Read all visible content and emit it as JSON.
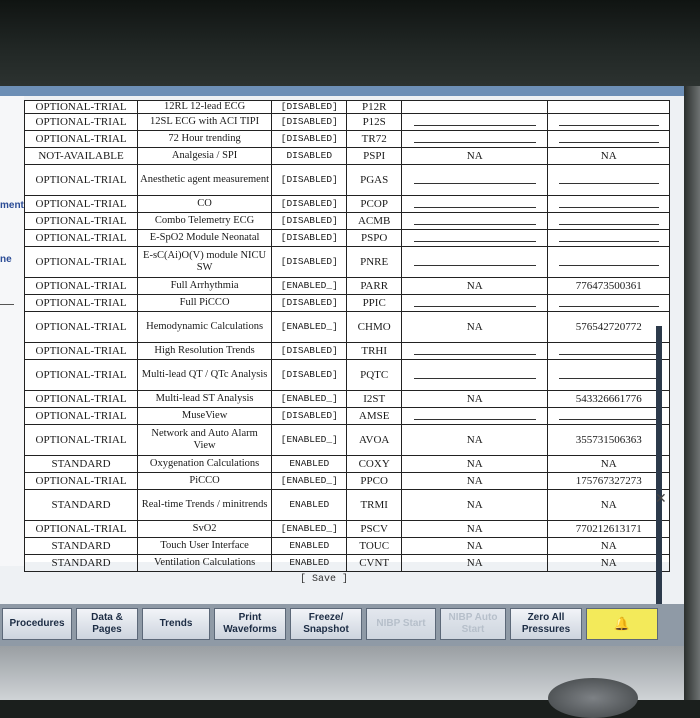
{
  "left_sidebar": {
    "label_1": "ment",
    "label_2": "ne"
  },
  "table": {
    "partial_row": {
      "status": "OPTIONAL-TRIAL",
      "feature": "12RL 12-lead ECG",
      "state": "[DISABLED]",
      "code": "P12R"
    },
    "rows": [
      {
        "status": "OPTIONAL-TRIAL",
        "feature": "12SL ECG with ACI TIPI",
        "state": "[DISABLED]",
        "code": "P12S",
        "a": "",
        "b": ""
      },
      {
        "status": "OPTIONAL-TRIAL",
        "feature": "72 Hour trending",
        "state": "[DISABLED]",
        "code": "TR72",
        "a": "",
        "b": ""
      },
      {
        "status": "NOT-AVAILABLE",
        "feature": "Analgesia / SPI",
        "state": "DISABLED",
        "code": "PSPI",
        "a": "NA",
        "b": "NA"
      },
      {
        "status": "OPTIONAL-TRIAL",
        "feature": "Anesthetic agent measurement",
        "state": "[DISABLED]",
        "code": "PGAS",
        "a": "",
        "b": "",
        "tall": true
      },
      {
        "status": "OPTIONAL-TRIAL",
        "feature": "CO",
        "state": "[DISABLED]",
        "code": "PCOP",
        "a": "",
        "b": ""
      },
      {
        "status": "OPTIONAL-TRIAL",
        "feature": "Combo Telemetry ECG",
        "state": "[DISABLED]",
        "code": "ACMB",
        "a": "",
        "b": ""
      },
      {
        "status": "OPTIONAL-TRIAL",
        "feature": "E-SpO2 Module Neonatal",
        "state": "[DISABLED]",
        "code": "PSPO",
        "a": "",
        "b": ""
      },
      {
        "status": "OPTIONAL-TRIAL",
        "feature": "E-sC(Ai)O(V) module NICU SW",
        "state": "[DISABLED]",
        "code": "PNRE",
        "a": "",
        "b": "",
        "tall": true
      },
      {
        "status": "OPTIONAL-TRIAL",
        "feature": "Full Arrhythmia",
        "state": "[ENABLED_]",
        "code": "PARR",
        "a": "NA",
        "b": "776473500361"
      },
      {
        "status": "OPTIONAL-TRIAL",
        "feature": "Full PiCCO",
        "state": "[DISABLED]",
        "code": "PPIC",
        "a": "",
        "b": ""
      },
      {
        "status": "OPTIONAL-TRIAL",
        "feature": "Hemodynamic Calculations",
        "state": "[ENABLED_]",
        "code": "CHMO",
        "a": "NA",
        "b": "576542720772",
        "tall": true
      },
      {
        "status": "OPTIONAL-TRIAL",
        "feature": "High Resolution Trends",
        "state": "[DISABLED]",
        "code": "TRHI",
        "a": "",
        "b": ""
      },
      {
        "status": "OPTIONAL-TRIAL",
        "feature": "Multi-lead QT / QTc Analysis",
        "state": "[DISABLED]",
        "code": "PQTC",
        "a": "",
        "b": "",
        "tall": true
      },
      {
        "status": "OPTIONAL-TRIAL",
        "feature": "Multi-lead ST Analysis",
        "state": "[ENABLED_]",
        "code": "I2ST",
        "a": "NA",
        "b": "543326661776"
      },
      {
        "status": "OPTIONAL-TRIAL",
        "feature": "MuseView",
        "state": "[DISABLED]",
        "code": "AMSE",
        "a": "",
        "b": ""
      },
      {
        "status": "OPTIONAL-TRIAL",
        "feature": "Network and Auto Alarm View",
        "state": "[ENABLED_]",
        "code": "AVOA",
        "a": "NA",
        "b": "355731506363",
        "tall": true
      },
      {
        "status": "STANDARD",
        "feature": "Oxygenation Calculations",
        "state": "ENABLED",
        "code": "COXY",
        "a": "NA",
        "b": "NA"
      },
      {
        "status": "OPTIONAL-TRIAL",
        "feature": "PiCCO",
        "state": "[ENABLED_]",
        "code": "PPCO",
        "a": "NA",
        "b": "175767327273"
      },
      {
        "status": "STANDARD",
        "feature": "Real-time Trends / minitrends",
        "state": "ENABLED",
        "code": "TRMI",
        "a": "NA",
        "b": "NA",
        "tall": true
      },
      {
        "status": "OPTIONAL-TRIAL",
        "feature": "SvO2",
        "state": "[ENABLED_]",
        "code": "PSCV",
        "a": "NA",
        "b": "770212613171"
      },
      {
        "status": "STANDARD",
        "feature": "Touch User Interface",
        "state": "ENABLED",
        "code": "TOUC",
        "a": "NA",
        "b": "NA"
      },
      {
        "status": "STANDARD",
        "feature": "Ventilation Calculations",
        "state": "ENABLED",
        "code": "CVNT",
        "a": "NA",
        "b": "NA"
      }
    ]
  },
  "save_label": "[ Save ]",
  "close_label": "✕",
  "bottom_bar": {
    "buttons": [
      {
        "label": "Procedures",
        "disabled": false
      },
      {
        "label": "Data & Pages",
        "disabled": false
      },
      {
        "label": "Trends",
        "disabled": false
      },
      {
        "label": "Print Waveforms",
        "disabled": false
      },
      {
        "label": "Freeze/ Snapshot",
        "disabled": false
      },
      {
        "label": "NIBP Start",
        "disabled": true
      },
      {
        "label": "NIBP Auto Start",
        "disabled": true
      },
      {
        "label": "Zero All Pressures",
        "disabled": false
      },
      {
        "label": "",
        "alarm": true,
        "icon": "alarm-bell-icon"
      }
    ]
  }
}
